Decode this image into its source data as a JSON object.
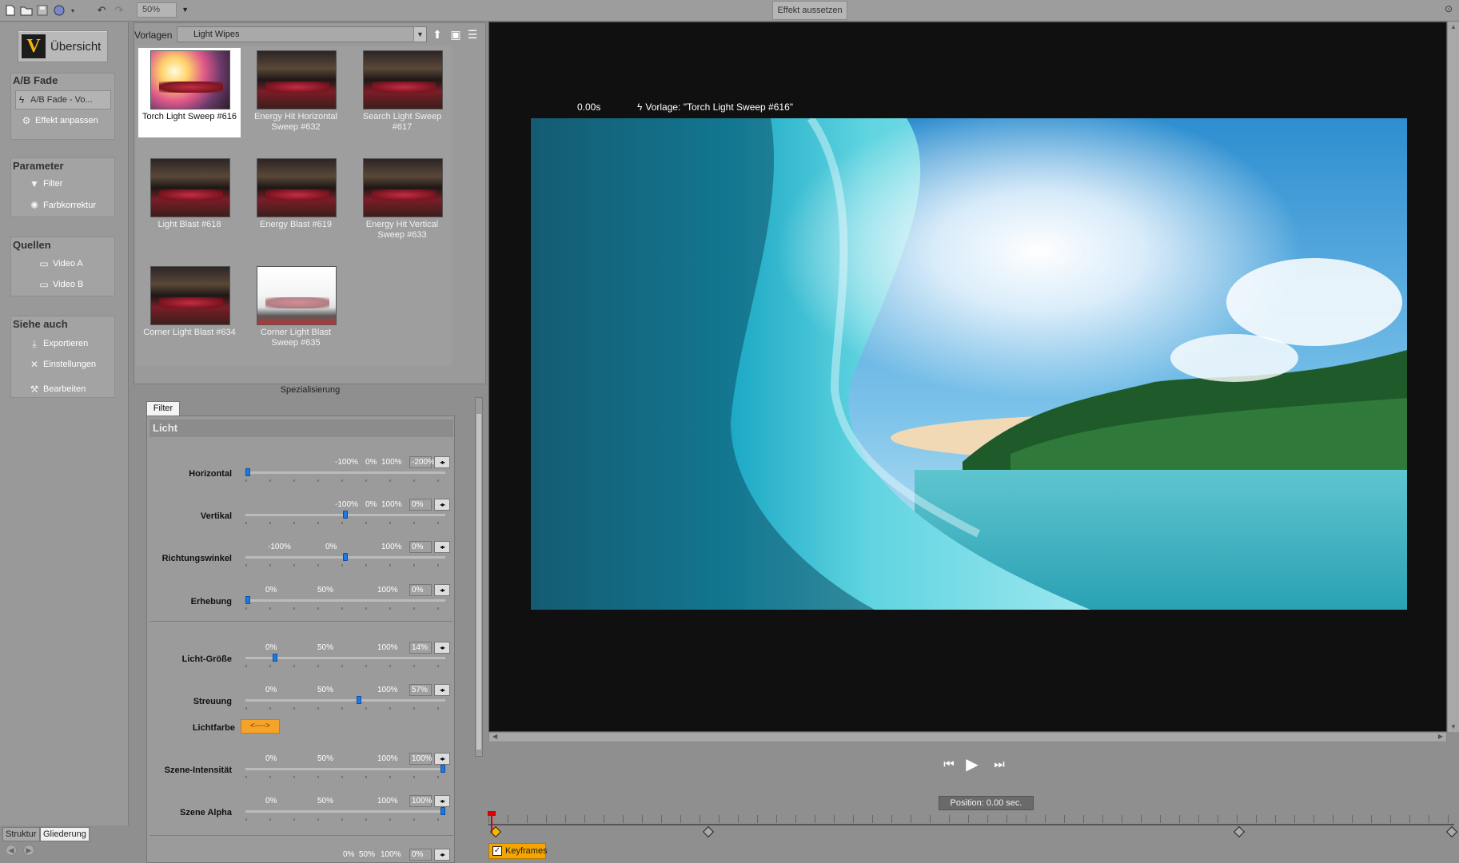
{
  "toolbar": {
    "zoom": "50%",
    "suspend_effect": "Effekt aussetzen",
    "icons": [
      "new-file-icon",
      "open-folder-icon",
      "save-icon",
      "run-script-icon",
      "undo-icon",
      "redo-icon",
      "pin-icon"
    ]
  },
  "nav": {
    "overview": "Übersicht",
    "logo_letter": "V",
    "groups": [
      {
        "title": "A/B Fade",
        "items": [
          "A/B Fade - Vo...",
          "Effekt anpassen"
        ]
      },
      {
        "title": "Parameter",
        "items": [
          "Filter",
          "Farbkorrektur"
        ]
      },
      {
        "title": "Quellen",
        "items": [
          "Video A",
          "Video B"
        ]
      },
      {
        "title": "Siehe auch",
        "items": [
          "Exportieren",
          "Einstellungen",
          "Bearbeiten"
        ]
      }
    ],
    "bottom_tabs": [
      "Struktur",
      "Gliederung"
    ]
  },
  "templates": {
    "label": "Vorlagen",
    "selected_category": "Light Wipes",
    "items": [
      "Torch Light Sweep #616",
      "Energy Hit Horizontal Sweep #632",
      "Search Light Sweep #617",
      "Light Blast #618",
      "Energy Blast #619",
      "Energy Hit Vertical Sweep #633",
      "Corner Light Blast #634",
      "Corner Light Blast Sweep #635"
    ],
    "footer": "Spezialisierung"
  },
  "filter": {
    "tab": "Filter",
    "section": "Licht",
    "params": [
      {
        "label": "Horizontal",
        "ticks": [
          "-100%",
          "0%",
          "100%"
        ],
        "value": "-200%",
        "level": 0.0
      },
      {
        "label": "Vertikal",
        "ticks": [
          "-100%",
          "0%",
          "100%"
        ],
        "value": "0%",
        "level": 0.5
      },
      {
        "label": "Richtungswinkel",
        "ticks": [
          "-100%",
          "0%",
          "100%"
        ],
        "value": "0%",
        "level": 0.5
      },
      {
        "label": "Erhebung",
        "ticks": [
          "0%",
          "50%",
          "100%"
        ],
        "value": "0%",
        "level": 0.0
      },
      {
        "label": "Licht-Größe",
        "ticks": [
          "0%",
          "50%",
          "100%"
        ],
        "value": "14%",
        "level": 0.14
      },
      {
        "label": "Streuung",
        "ticks": [
          "0%",
          "50%",
          "100%"
        ],
        "value": "57%",
        "level": 0.57
      },
      {
        "label": "Szene-Intensität",
        "ticks": [
          "0%",
          "50%",
          "100%"
        ],
        "value": "100%",
        "level": 1.0
      },
      {
        "label": "Szene Alpha",
        "ticks": [
          "0%",
          "50%",
          "100%"
        ],
        "value": "100%",
        "level": 1.0
      }
    ],
    "color_label": "Lichtfarbe",
    "color_swatch": "<---->",
    "color_value": "#f6a32a",
    "last_row": {
      "ticks": [
        "0%",
        "50%",
        "100%"
      ],
      "value": "0%"
    }
  },
  "preview": {
    "time": "0.00s",
    "template": "Vorlage: \"Torch Light Sweep #616\""
  },
  "transport": {
    "position": "Position: 0.00 sec.",
    "keyframes_label": "Keyframes",
    "keyframes_checked": "✓"
  }
}
